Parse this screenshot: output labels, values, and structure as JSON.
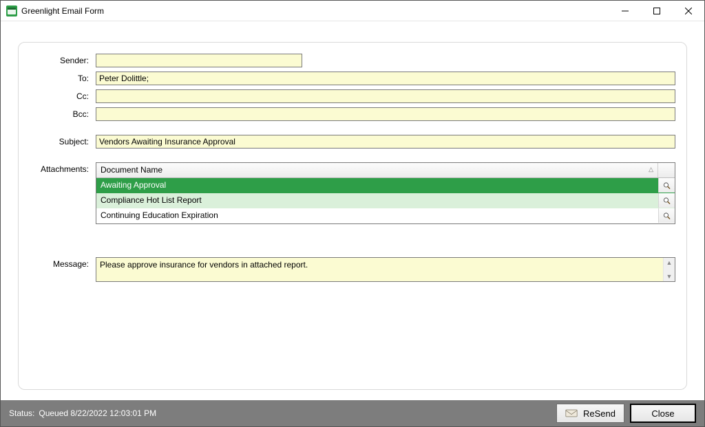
{
  "window": {
    "title": "Greenlight Email Form"
  },
  "labels": {
    "sender": "Sender:",
    "to": "To:",
    "cc": "Cc:",
    "bcc": "Bcc:",
    "subject": "Subject:",
    "attachments": "Attachments:",
    "message": "Message:"
  },
  "fields": {
    "sender": "",
    "to": "Peter Dolittle;",
    "cc": "",
    "bcc": "",
    "subject": "Vendors Awaiting Insurance Approval",
    "message": "Please approve insurance for vendors in attached report."
  },
  "attachments": {
    "header": "Document Name",
    "rows": [
      {
        "name": "Awaiting Approval",
        "state": "sel"
      },
      {
        "name": "Compliance Hot List Report",
        "state": "alt"
      },
      {
        "name": "Continuing Education Expiration",
        "state": "plain"
      }
    ]
  },
  "status": {
    "label": "Status:",
    "text": "Queued 8/22/2022 12:03:01 PM"
  },
  "buttons": {
    "resend": "ReSend",
    "close": "Close"
  }
}
